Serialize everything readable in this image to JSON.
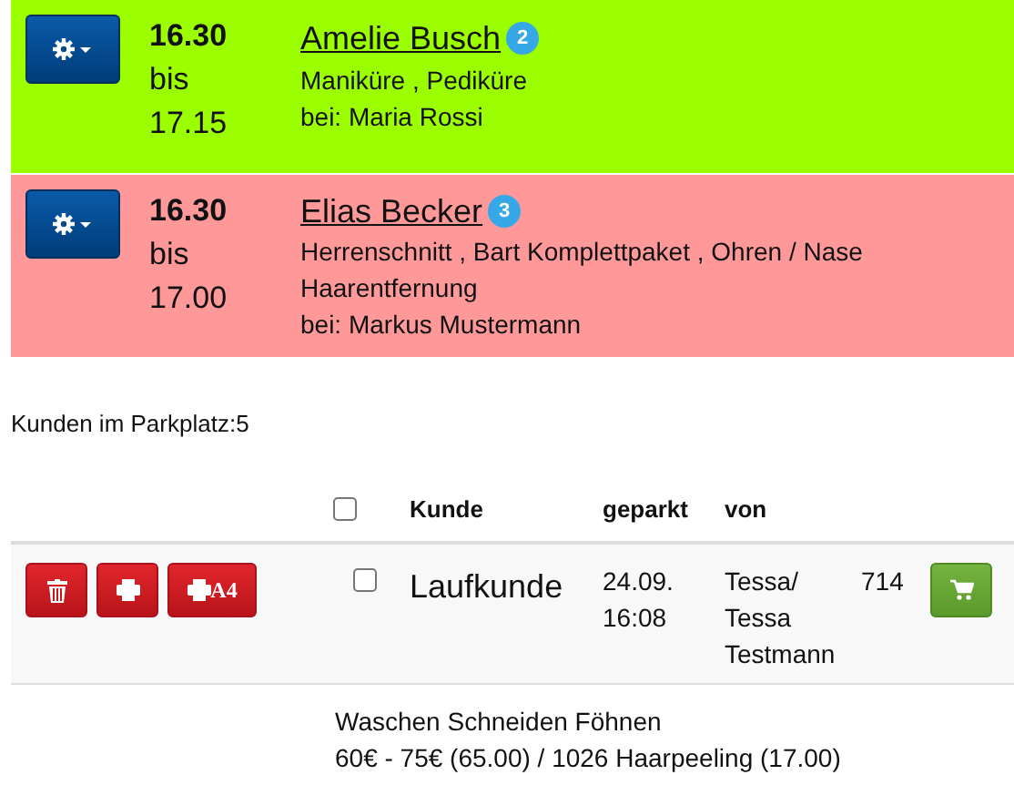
{
  "appointments": [
    {
      "start": "16.30",
      "sep": "bis",
      "end": "17.15",
      "customer": "Amelie Busch",
      "count": "2",
      "services": "Maniküre , Pediküre",
      "staff": "bei: Maria Rossi",
      "color": "#9cff00"
    },
    {
      "start": "16.30",
      "sep": "bis",
      "end": "17.00",
      "customer": "Elias Becker",
      "count": "3",
      "services": "Herrenschnitt , Bart Komplettpaket , Ohren / Nase Haarentfernung",
      "staff": "bei: Markus Mustermann",
      "color": "#ff9999"
    }
  ],
  "parking_summary": "Kunden im Parkplatz:5",
  "table": {
    "select_all_checked": false,
    "columns": [
      "Kunde",
      "geparkt",
      "von"
    ],
    "rows": [
      {
        "checked": false,
        "print_a4_label": "A4",
        "customer": "Laufkunde",
        "parked": [
          "24.09.",
          "16:08"
        ],
        "by": [
          "Tessa/",
          "Tessa",
          "Testmann"
        ],
        "number": "714",
        "details": [
          "Waschen Schneiden Föhnen",
          "60€ - 75€ (65.00) / 1026 Haarpeeling (17.00)"
        ]
      }
    ]
  }
}
